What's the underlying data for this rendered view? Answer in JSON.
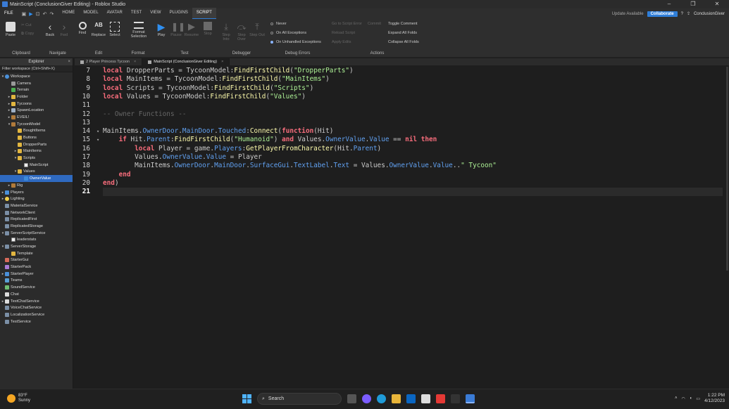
{
  "window": {
    "title": "MainScript (ConclusionGiver Editing) - Roblox Studio",
    "minimize": "–",
    "maximize": "❐",
    "close": "✕"
  },
  "menubar": {
    "file": "FILE",
    "tabs": [
      "HOME",
      "MODEL",
      "AVATAR",
      "TEST",
      "VIEW",
      "PLUGINS",
      "SCRIPT"
    ],
    "active_tab": "SCRIPT",
    "update_label": "Update Available",
    "collaborate_label": "Collaborate",
    "user_name": "ConclusionGiver"
  },
  "ribbon": {
    "clipboard": {
      "paste": "Paste",
      "cut": "Cut",
      "copy": "Copy",
      "label": "Clipboard"
    },
    "navigate": {
      "back": "Back",
      "fwd": "Fwd",
      "label": "Navigate"
    },
    "edit": {
      "find": "Find",
      "replace": "Replace",
      "select": "Select",
      "label": "Edit"
    },
    "format": {
      "format_selection": "Format Selection",
      "label": "Format"
    },
    "test": {
      "play": "Play",
      "pause": "Pause",
      "resume": "Resume",
      "stop": "Stop",
      "label": "Test"
    },
    "debugger": {
      "step_into": "Step Into",
      "step_over": "Step Over",
      "step_out": "Step Out",
      "label": "Debugger"
    },
    "debug_errors": {
      "never": "Never",
      "all": "On All Exceptions",
      "unhandled": "On Unhandled Exceptions",
      "label": "Debug Errors"
    },
    "actions": {
      "go_to_error": "Go to Script Error",
      "commit": "Commit",
      "reload": "Reload Script",
      "apply_edits": "Apply Edits",
      "toggle_comment": "Toggle Comment",
      "expand_all": "Expand All Folds",
      "collapse_all": "Collapse All Folds",
      "label": "Actions"
    }
  },
  "explorer": {
    "title": "Explorer",
    "filter_placeholder": "Filter workspace (Ctrl+Shift+X)",
    "items": [
      {
        "label": "Workspace",
        "icon": "ws",
        "indent": 0,
        "arrow": "▾"
      },
      {
        "label": "Camera",
        "icon": "cam",
        "indent": 1,
        "arrow": ""
      },
      {
        "label": "Terrain",
        "icon": "terrain",
        "indent": 1,
        "arrow": ""
      },
      {
        "label": "Folder",
        "icon": "folder",
        "indent": 1,
        "arrow": "▸"
      },
      {
        "label": "Tycoons",
        "icon": "folder",
        "indent": 1,
        "arrow": "▸"
      },
      {
        "label": "SpawnLocation",
        "icon": "part",
        "indent": 1,
        "arrow": "▸"
      },
      {
        "label": "EVEIL!",
        "icon": "model",
        "indent": 1,
        "arrow": "▸"
      },
      {
        "label": "TycoonModel",
        "icon": "model",
        "indent": 1,
        "arrow": "▾"
      },
      {
        "label": "BoughtItems",
        "icon": "folder",
        "indent": 2,
        "arrow": ""
      },
      {
        "label": "Buttons",
        "icon": "folder",
        "indent": 2,
        "arrow": ""
      },
      {
        "label": "DropperParts",
        "icon": "folder",
        "indent": 2,
        "arrow": ""
      },
      {
        "label": "MainItems",
        "icon": "folder",
        "indent": 2,
        "arrow": "▸"
      },
      {
        "label": "Scripts",
        "icon": "folder",
        "indent": 2,
        "arrow": "▾"
      },
      {
        "label": "MainScript",
        "icon": "script",
        "indent": 3,
        "arrow": ""
      },
      {
        "label": "Values",
        "icon": "folder",
        "indent": 2,
        "arrow": "▾"
      },
      {
        "label": "OwnerValue",
        "icon": "value",
        "indent": 3,
        "arrow": "",
        "selected": true
      },
      {
        "label": "Rig",
        "icon": "model",
        "indent": 1,
        "arrow": "▸"
      },
      {
        "label": "Players",
        "icon": "players",
        "indent": 0,
        "arrow": "▸"
      },
      {
        "label": "Lighting",
        "icon": "light",
        "indent": 0,
        "arrow": "▸"
      },
      {
        "label": "MaterialService",
        "icon": "svc",
        "indent": 0,
        "arrow": ""
      },
      {
        "label": "NetworkClient",
        "icon": "svc",
        "indent": 0,
        "arrow": ""
      },
      {
        "label": "ReplicatedFirst",
        "icon": "svc",
        "indent": 0,
        "arrow": ""
      },
      {
        "label": "ReplicatedStorage",
        "icon": "svc",
        "indent": 0,
        "arrow": ""
      },
      {
        "label": "ServerScriptService",
        "icon": "svc",
        "indent": 0,
        "arrow": "▾"
      },
      {
        "label": "leaderstats",
        "icon": "script",
        "indent": 1,
        "arrow": ""
      },
      {
        "label": "ServerStorage",
        "icon": "svc",
        "indent": 0,
        "arrow": "▾"
      },
      {
        "label": "Template",
        "icon": "folder",
        "indent": 1,
        "arrow": ""
      },
      {
        "label": "StarterGui",
        "icon": "gui",
        "indent": 0,
        "arrow": ""
      },
      {
        "label": "StarterPack",
        "icon": "tool",
        "indent": 0,
        "arrow": ""
      },
      {
        "label": "StarterPlayer",
        "icon": "players",
        "indent": 0,
        "arrow": "▸"
      },
      {
        "label": "Teams",
        "icon": "teams",
        "indent": 0,
        "arrow": ""
      },
      {
        "label": "SoundService",
        "icon": "sound",
        "indent": 0,
        "arrow": ""
      },
      {
        "label": "Chat",
        "icon": "chat",
        "indent": 0,
        "arrow": ""
      },
      {
        "label": "TextChatService",
        "icon": "chat",
        "indent": 0,
        "arrow": "▸"
      },
      {
        "label": "VoiceChatService",
        "icon": "svc",
        "indent": 0,
        "arrow": ""
      },
      {
        "label": "LocalizationService",
        "icon": "svc",
        "indent": 0,
        "arrow": ""
      },
      {
        "label": "TestService",
        "icon": "svc",
        "indent": 0,
        "arrow": ""
      }
    ]
  },
  "editor": {
    "tabs": [
      {
        "label": "2 Player Princess Tycoon",
        "active": false
      },
      {
        "label": "MainScript (ConclusionGiver Editing)",
        "active": true
      }
    ],
    "current_line": 21,
    "lines": [
      {
        "n": 7,
        "tokens": [
          [
            "kw",
            "local"
          ],
          [
            "txt",
            " DropperParts = TycoonModel:"
          ],
          [
            "fn",
            "FindFirstChild"
          ],
          [
            "txt",
            "("
          ],
          [
            "str",
            "\"DropperParts\""
          ],
          [
            "txt",
            ")"
          ]
        ]
      },
      {
        "n": 8,
        "tokens": [
          [
            "kw",
            "local"
          ],
          [
            "txt",
            " MainItems = TycoonModel:"
          ],
          [
            "fn",
            "FindFirstChild"
          ],
          [
            "txt",
            "("
          ],
          [
            "str",
            "\"MainItems\""
          ],
          [
            "txt",
            ")"
          ]
        ]
      },
      {
        "n": 9,
        "tokens": [
          [
            "kw",
            "local"
          ],
          [
            "txt",
            " Scripts = TycoonModel:"
          ],
          [
            "fn",
            "FindFirstChild"
          ],
          [
            "txt",
            "("
          ],
          [
            "str",
            "\"Scripts\""
          ],
          [
            "txt",
            ")"
          ]
        ]
      },
      {
        "n": 10,
        "tokens": [
          [
            "kw",
            "local"
          ],
          [
            "txt",
            " Values = TycoonModel:"
          ],
          [
            "fn",
            "FindFirstChild"
          ],
          [
            "txt",
            "("
          ],
          [
            "str",
            "\"Values\""
          ],
          [
            "txt",
            ")"
          ]
        ]
      },
      {
        "n": 11,
        "tokens": []
      },
      {
        "n": 12,
        "tokens": [
          [
            "cmt",
            "-- Owner Functions --"
          ]
        ]
      },
      {
        "n": 13,
        "tokens": []
      },
      {
        "n": 14,
        "fold": "▾",
        "tokens": [
          [
            "txt",
            "MainItems."
          ],
          [
            "mem",
            "OwnerDoor"
          ],
          [
            "txt",
            "."
          ],
          [
            "mem",
            "MainDoor"
          ],
          [
            "txt",
            "."
          ],
          [
            "mem",
            "Touched"
          ],
          [
            "txt",
            ":"
          ],
          [
            "fn",
            "Connect"
          ],
          [
            "txt",
            "("
          ],
          [
            "kw",
            "function"
          ],
          [
            "txt",
            "(Hit)"
          ]
        ]
      },
      {
        "n": 15,
        "fold": "▾",
        "tokens": [
          [
            "txt",
            "    "
          ],
          [
            "kw",
            "if"
          ],
          [
            "txt",
            " Hit."
          ],
          [
            "mem",
            "Parent"
          ],
          [
            "txt",
            ":"
          ],
          [
            "fn",
            "FindFirstChild"
          ],
          [
            "txt",
            "("
          ],
          [
            "str",
            "\"Humanoid\""
          ],
          [
            "txt",
            ") "
          ],
          [
            "kw",
            "and"
          ],
          [
            "txt",
            " Values."
          ],
          [
            "mem",
            "OwnerValue"
          ],
          [
            "txt",
            "."
          ],
          [
            "mem",
            "Value"
          ],
          [
            "txt",
            " == "
          ],
          [
            "kw",
            "nil"
          ],
          [
            "txt",
            " "
          ],
          [
            "kw",
            "then"
          ]
        ]
      },
      {
        "n": 16,
        "tokens": [
          [
            "txt",
            "        "
          ],
          [
            "kw",
            "local"
          ],
          [
            "txt",
            " Player = game."
          ],
          [
            "mem",
            "Players"
          ],
          [
            "txt",
            ":"
          ],
          [
            "fn",
            "GetPlayerFromCharacter"
          ],
          [
            "txt",
            "(Hit."
          ],
          [
            "mem",
            "Parent"
          ],
          [
            "txt",
            ")"
          ]
        ]
      },
      {
        "n": 17,
        "tokens": [
          [
            "txt",
            "        Values."
          ],
          [
            "mem",
            "OwnerValue"
          ],
          [
            "txt",
            "."
          ],
          [
            "mem",
            "Value"
          ],
          [
            "txt",
            " = Player"
          ]
        ]
      },
      {
        "n": 18,
        "tokens": [
          [
            "txt",
            "        MainItems."
          ],
          [
            "mem",
            "OwnerDoor"
          ],
          [
            "txt",
            "."
          ],
          [
            "mem",
            "MainDoor"
          ],
          [
            "txt",
            "."
          ],
          [
            "mem",
            "SurfaceGui"
          ],
          [
            "txt",
            "."
          ],
          [
            "mem",
            "TextLabel"
          ],
          [
            "txt",
            "."
          ],
          [
            "mem",
            "Text"
          ],
          [
            "txt",
            " = Values."
          ],
          [
            "mem",
            "OwnerValue"
          ],
          [
            "txt",
            "."
          ],
          [
            "mem",
            "Value"
          ],
          [
            "txt",
            ".."
          ],
          [
            "str",
            "\" Tycoon\""
          ]
        ]
      },
      {
        "n": 19,
        "tokens": [
          [
            "txt",
            "    "
          ],
          [
            "kw",
            "end"
          ]
        ]
      },
      {
        "n": 20,
        "tokens": [
          [
            "kw",
            "end"
          ],
          [
            "txt",
            ")"
          ]
        ]
      },
      {
        "n": 21,
        "tokens": []
      }
    ]
  },
  "taskbar": {
    "temp": "83°F",
    "condition": "Sunny",
    "search_label": "Search",
    "time": "1:22 PM",
    "date": "4/12/2023"
  },
  "colors": {
    "accent": "#2f7ed8",
    "keyword": "#f86d7c",
    "string": "#adf195",
    "member": "#61a1f1",
    "function": "#fdfbac",
    "comment": "#666666"
  }
}
